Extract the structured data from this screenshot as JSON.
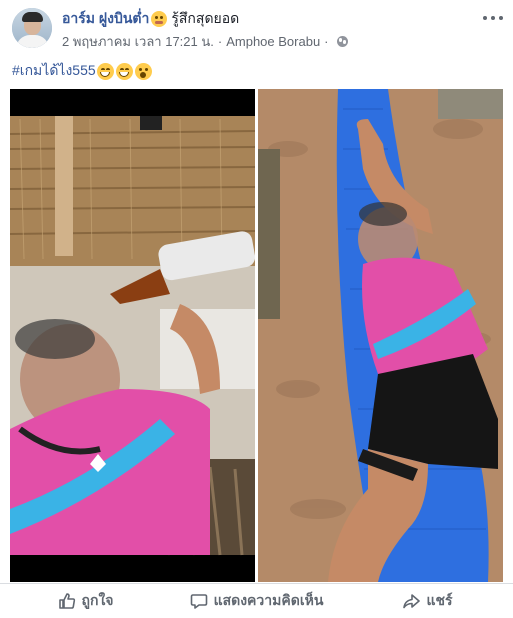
{
  "post": {
    "author_name": "อาร์ม ฝูงบินต่ำ",
    "author_emoji": "cry-face-icon",
    "feeling": "รู้สึกสุดยอด",
    "timestamp": "2 พฤษภาคม เวลา 17:21 น.",
    "location": "Amphoe Borabu",
    "separator": "·",
    "privacy_icon": "globe-icon",
    "text_hashtag": "#เกมได้ไง555",
    "text_emojis": [
      "laughing-face-icon",
      "laughing-face-icon",
      "surprised-face-icon"
    ],
    "colors": {
      "link": "#365899",
      "meta": "#616770",
      "action": "#606770",
      "border": "#dadde1"
    }
  },
  "photos": {
    "left": {
      "description_icon": "photo-person-drinking-bottle",
      "shirt_color": "#e24fa8"
    },
    "right": {
      "description_icon": "photo-person-in-blue-hammock",
      "hammock_color": "#2e6fe0"
    }
  },
  "actions": {
    "like_label": "ถูกใจ",
    "comment_label": "แสดงความคิดเห็น",
    "share_label": "แชร์"
  }
}
